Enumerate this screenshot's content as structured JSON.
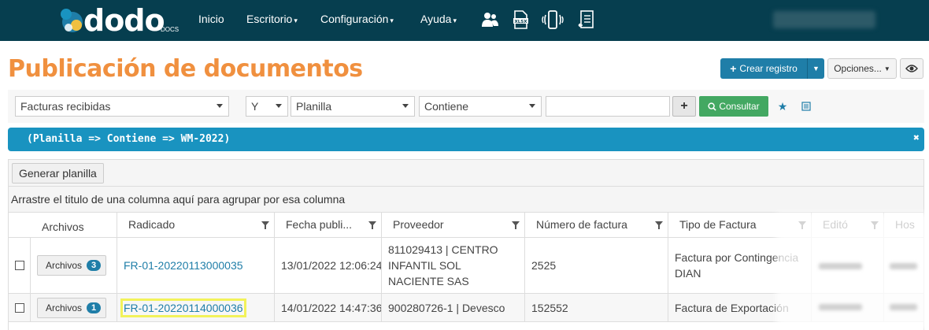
{
  "nav": {
    "logo_text": "dodo",
    "logo_sub": "DOCS",
    "items": [
      {
        "label": "Inicio"
      },
      {
        "label": "Escritorio"
      },
      {
        "label": "Configuración"
      },
      {
        "label": "Ayuda"
      }
    ],
    "icons": [
      "users-icon",
      "xlsx-file-icon",
      "mobile-vibrate-icon",
      "document-return-icon"
    ]
  },
  "page": {
    "title": "Publicación de documentos",
    "create_label": "Crear registro",
    "options_label": "Opciones..."
  },
  "filters": {
    "document_type": "Facturas recibidas",
    "logic": "Y",
    "field": "Planilla",
    "operator": "Contiene",
    "value": "",
    "consult_label": "Consultar"
  },
  "query": {
    "text": "(Planilla => Contiene => WM-2022)"
  },
  "grid": {
    "generate_label": "Generar planilla",
    "group_hint": "Arrastre el titulo de una columna aquí para agrupar por esa columna",
    "columns": [
      "Archivos",
      "Radicado",
      "Fecha publi...",
      "Proveedor",
      "Número de factura",
      "Tipo de Factura",
      "Editó",
      "Hos"
    ],
    "rows": [
      {
        "files_label": "Archivos",
        "files_count": "3",
        "radicado": "FR-01-20220113000035",
        "fecha": "13/01/2022 12:06:24",
        "proveedor": "811029413 | CENTRO INFANTIL SOL NACIENTE SAS",
        "numero": "2525",
        "tipo": "Factura por Contingencia DIAN"
      },
      {
        "files_label": "Archivos",
        "files_count": "1",
        "radicado": "FR-01-20220114000036",
        "fecha": "14/01/2022 14:47:36",
        "proveedor": "900280726-1 | Devesco",
        "numero": "152552",
        "tipo": "Factura de Exportación"
      }
    ]
  },
  "colors": {
    "navbar": "#063e4f",
    "title": "#f0903f",
    "primary": "#1f7ea8",
    "success": "#43a862",
    "banner": "#1993c0",
    "highlight": "#f2f25a"
  }
}
